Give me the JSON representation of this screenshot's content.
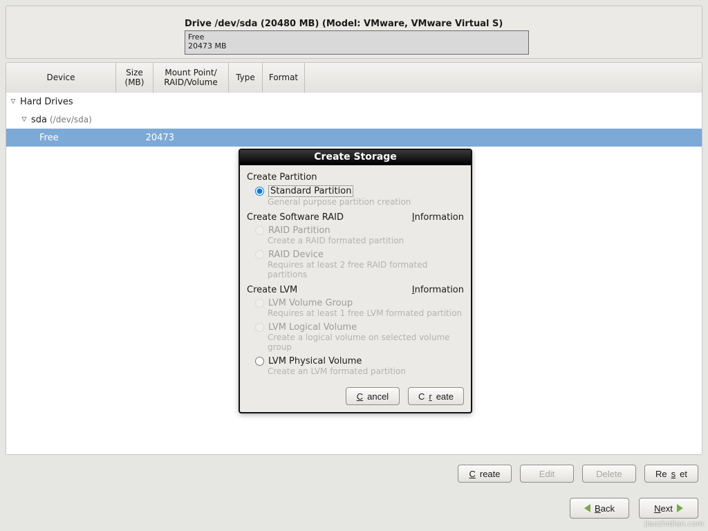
{
  "drive": {
    "title": "Drive /dev/sda (20480 MB) (Model: VMware, VMware Virtual S)",
    "map_label": "Free",
    "map_size": "20473 MB"
  },
  "columns": {
    "device": "Device",
    "size": "Size\n(MB)",
    "mount": "Mount Point/\nRAID/Volume",
    "type": "Type",
    "format": "Format"
  },
  "tree": {
    "root": "Hard Drives",
    "disk_name": "sda",
    "disk_path": "(/dev/sda)",
    "free_label": "Free",
    "free_size": "20473"
  },
  "dialog": {
    "title": "Create Storage",
    "section_partition": "Create Partition",
    "standard_partition": "Standard Partition",
    "standard_hint": "General purpose partition creation",
    "section_raid": "Create Software RAID",
    "info_label": "Information",
    "raid_partition": "RAID Partition",
    "raid_partition_hint": "Create a RAID formated partition",
    "raid_device": "RAID Device",
    "raid_device_hint": "Requires at least 2 free RAID formated partitions",
    "section_lvm": "Create LVM",
    "lvm_vg": "LVM Volume Group",
    "lvm_vg_hint": "Requires at least 1 free LVM formated partition",
    "lvm_lv": "LVM Logical Volume",
    "lvm_lv_hint": "Create a logical volume on selected volume group",
    "lvm_pv": "LVM Physical Volume",
    "lvm_pv_hint": "Create an LVM formated partition",
    "cancel": "Cancel",
    "create": "Create"
  },
  "actions": {
    "create": "Create",
    "edit": "Edit",
    "delete": "Delete",
    "reset": "Reset"
  },
  "nav": {
    "back": "Back",
    "next": "Next"
  },
  "watermark": "jiaozhidian.com"
}
